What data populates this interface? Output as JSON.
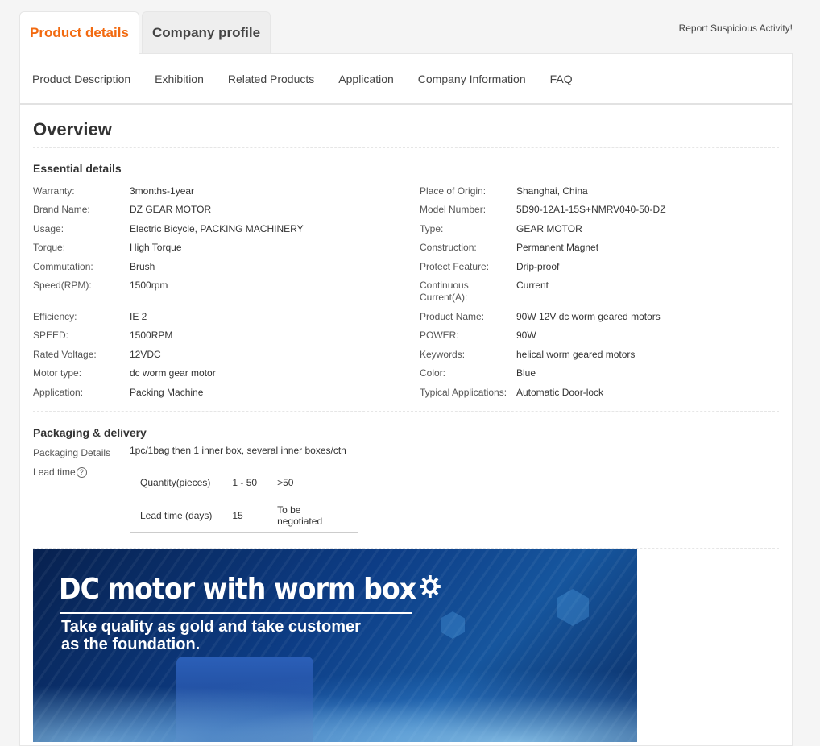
{
  "tabs": {
    "product_details": "Product details",
    "company_profile": "Company profile"
  },
  "report_link": "Report Suspicious Activity!",
  "subnav": [
    "Product Description",
    "Exhibition",
    "Related Products",
    "Application",
    "Company Information",
    "FAQ"
  ],
  "overview_title": "Overview",
  "essential": {
    "title": "Essential details",
    "left": [
      {
        "label": "Warranty:",
        "value": "3months-1year"
      },
      {
        "label": "Brand Name:",
        "value": "DZ GEAR MOTOR"
      },
      {
        "label": "Usage:",
        "value": "Electric Bicycle, PACKING MACHINERY"
      },
      {
        "label": "Torque:",
        "value": "High Torque"
      },
      {
        "label": "Commutation:",
        "value": "Brush"
      },
      {
        "label": "Speed(RPM):",
        "value": "1500rpm"
      },
      {
        "label": "Efficiency:",
        "value": "IE 2"
      },
      {
        "label": "SPEED:",
        "value": "1500RPM"
      },
      {
        "label": "Rated Voltage:",
        "value": "12VDC"
      },
      {
        "label": "Motor type:",
        "value": "dc worm gear motor"
      },
      {
        "label": "Application:",
        "value": "Packing Machine"
      }
    ],
    "right": [
      {
        "label": "Place of Origin:",
        "value": "Shanghai, China"
      },
      {
        "label": "Model Number:",
        "value": "5D90-12A1-15S+NMRV040-50-DZ"
      },
      {
        "label": "Type:",
        "value": "GEAR MOTOR"
      },
      {
        "label": "Construction:",
        "value": "Permanent Magnet"
      },
      {
        "label": "Protect Feature:",
        "value": "Drip-proof"
      },
      {
        "label": "Continuous Current(A):",
        "value": "Current"
      },
      {
        "label": "Product Name:",
        "value": "90W 12V dc worm geared motors"
      },
      {
        "label": "POWER:",
        "value": "90W"
      },
      {
        "label": "Keywords:",
        "value": "helical worm geared motors"
      },
      {
        "label": "Color:",
        "value": "Blue"
      },
      {
        "label": "Typical Applications:",
        "value": "Automatic Door-lock"
      }
    ]
  },
  "packaging": {
    "title": "Packaging & delivery",
    "details_label": "Packaging Details",
    "details_value": "1pc/1bag then 1 inner box, several inner boxes/ctn",
    "lead_label": "Lead time",
    "lead_help_icon": "?",
    "lead_table": [
      [
        "Quantity(pieces)",
        "1 - 50",
        ">50"
      ],
      [
        "Lead time (days)",
        "15",
        "To be negotiated"
      ]
    ]
  },
  "banner": {
    "title": "DC motor with worm box",
    "subtitle_line1": "Take quality as gold and take customer",
    "subtitle_line2": "as the foundation.",
    "accent_color": "#0d3d86"
  },
  "colors": {
    "accent": "#f26a10"
  }
}
